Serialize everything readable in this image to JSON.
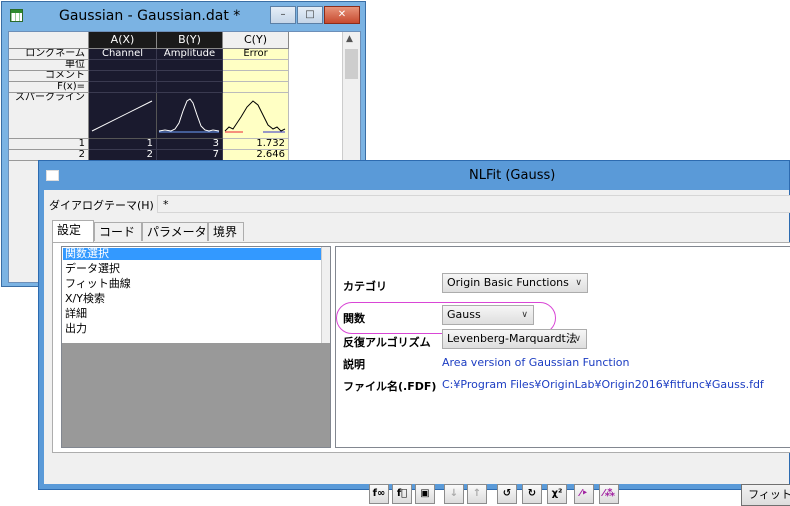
{
  "worksheet": {
    "title": "Gaussian - Gaussian.dat *",
    "window_buttons": [
      "–",
      "□",
      "✕"
    ],
    "columns": [
      {
        "header": "A(X)",
        "long_name": "Channel",
        "selected": true
      },
      {
        "header": "B(Y)",
        "long_name": "Amplitude",
        "selected": true
      },
      {
        "header": "C(Y)",
        "long_name": "Error",
        "selected": false
      }
    ],
    "row_labels": [
      "ロングネーム",
      "単位",
      "コメント",
      "F(x)=",
      "スパークライン"
    ],
    "data_rows": [
      {
        "index": "1",
        "a": "1",
        "b": "3",
        "c": "1.732"
      },
      {
        "index": "2",
        "a": "2",
        "b": "7",
        "c": "2.646"
      }
    ]
  },
  "dialog": {
    "title": "NLFit (Gauss)",
    "theme_label": "ダイアログテーマ(H)",
    "theme_value": "*",
    "tabs": [
      "設定",
      "コード",
      "パラメータ",
      "境界"
    ],
    "active_tab": 0,
    "left_items": [
      "関数選択",
      "データ選択",
      "フィット曲線",
      "X/Y検索",
      "詳細",
      "出力"
    ],
    "selected_item": 0,
    "fields": {
      "category_label": "カテゴリ",
      "category_value": "Origin Basic Functions",
      "function_label": "関数",
      "function_value": "Gauss",
      "algorithm_label": "反復アルゴリズム",
      "algorithm_value": "Levenberg-Marquardt法",
      "description_label": "説明",
      "description_value": "Area version of Gaussian Function",
      "filename_label": "ファイル名(.FDF)",
      "filename_value": "C:¥Program Files¥OriginLab¥Origin2016¥fitfunc¥Gauss.fdf"
    },
    "toolbar_icons": [
      {
        "name": "fx-new-icon",
        "glyph": "f∞"
      },
      {
        "name": "fx-edit-icon",
        "glyph": "f⃞"
      },
      {
        "name": "save-icon",
        "glyph": "▣"
      },
      {
        "name": "sort-down-icon",
        "glyph": "↓"
      },
      {
        "name": "sort-up-icon",
        "glyph": "↑"
      },
      {
        "name": "one-iteration-icon",
        "glyph": "↺"
      },
      {
        "name": "iterations-icon",
        "glyph": "↻"
      },
      {
        "name": "chi-square-icon",
        "glyph": "χ²"
      },
      {
        "name": "fit-until-converge-icon",
        "glyph": "⁄‣"
      },
      {
        "name": "fit-all-icon",
        "glyph": "⁄⁂"
      }
    ],
    "fit_button": "フィット"
  },
  "colors": {
    "highlight_ring": "#d946d6",
    "link_text": "#1c3dc2",
    "selection": "#3399ff"
  }
}
